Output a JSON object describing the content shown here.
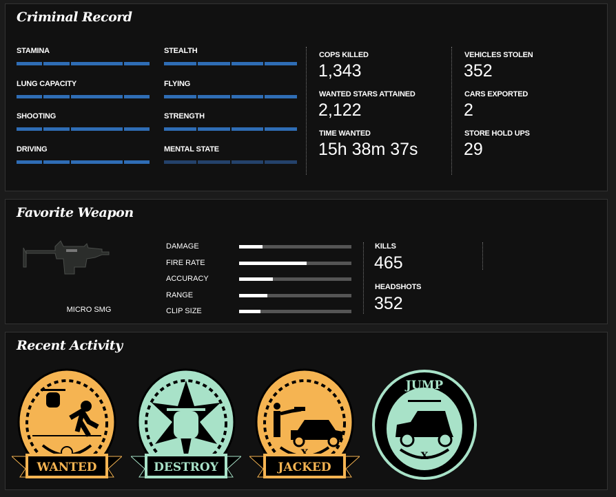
{
  "criminal_record": {
    "title": "Criminal Record",
    "skills": [
      {
        "label": "STAMINA",
        "value": 1.0
      },
      {
        "label": "STEALTH",
        "value": 1.0
      },
      {
        "label": "LUNG CAPACITY",
        "value": 1.0
      },
      {
        "label": "FLYING",
        "value": 1.0
      },
      {
        "label": "SHOOTING",
        "value": 1.0
      },
      {
        "label": "STRENGTH",
        "value": 1.0
      },
      {
        "label": "DRIVING",
        "value": 1.0
      },
      {
        "label": "MENTAL STATE",
        "value": 0.0
      }
    ],
    "stats": [
      {
        "label": "COPS KILLED",
        "value": "1,343"
      },
      {
        "label": "WANTED STARS ATTAINED",
        "value": "2,122"
      },
      {
        "label": "TIME WANTED",
        "value": "15h 38m 37s"
      },
      {
        "label": "VEHICLES STOLEN",
        "value": "352"
      },
      {
        "label": "CARS EXPORTED",
        "value": "2"
      },
      {
        "label": "STORE HOLD UPS",
        "value": "29"
      }
    ]
  },
  "favorite_weapon": {
    "title": "Favorite Weapon",
    "name": "MICRO SMG",
    "stats": [
      {
        "label": "DAMAGE",
        "value": 0.21
      },
      {
        "label": "FIRE RATE",
        "value": 0.6
      },
      {
        "label": "ACCURACY",
        "value": 0.3
      },
      {
        "label": "RANGE",
        "value": 0.25
      },
      {
        "label": "CLIP SIZE",
        "value": 0.19
      }
    ],
    "kills_label": "KILLS",
    "kills": "465",
    "headshots_label": "HEADSHOTS",
    "headshots": "352"
  },
  "recent_activity": {
    "title": "Recent Activity",
    "badges": [
      {
        "label": "WANTED",
        "color": "#f5b452"
      },
      {
        "label": "DESTROY",
        "color": "#a8e2c8"
      },
      {
        "label": "JACKED",
        "color": "#f5b452"
      },
      {
        "label": "JUMP",
        "color": "#a8e2c8"
      }
    ]
  }
}
